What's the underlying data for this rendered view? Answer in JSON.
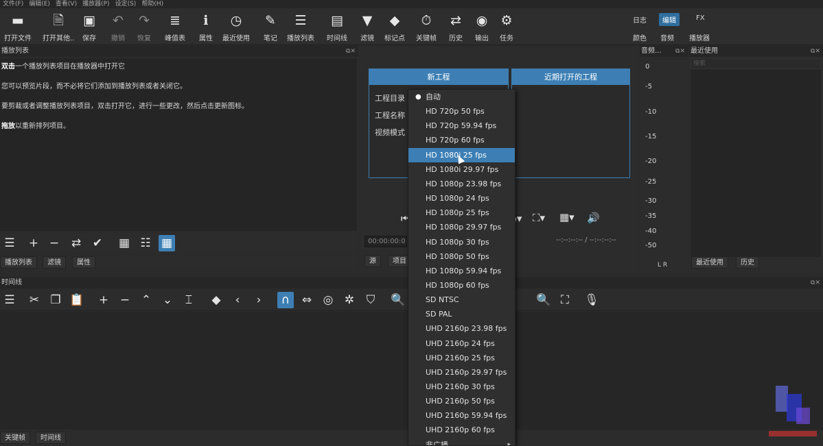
{
  "menu": [
    "文件(F)",
    "编辑(E)",
    "查看(V)",
    "播放器(P)",
    "设定(S)",
    "帮助(H)"
  ],
  "toolbar": [
    {
      "label": "打开文件",
      "icon": "open-file-icon",
      "glyph": "▬",
      "dim": false
    },
    {
      "label": "打开其他..",
      "icon": "open-other-icon",
      "glyph": "🗎",
      "dim": false
    },
    {
      "label": "保存",
      "icon": "save-icon",
      "glyph": "▣",
      "dim": false
    },
    {
      "label": "撤销",
      "icon": "undo-icon",
      "glyph": "↶",
      "dim": true
    },
    {
      "label": "恢复",
      "icon": "redo-icon",
      "glyph": "↷",
      "dim": true
    },
    {
      "label": "峰值表",
      "icon": "peak-meter-icon",
      "glyph": "≣",
      "dim": false
    },
    {
      "label": "属性",
      "icon": "info-icon",
      "glyph": "ℹ",
      "dim": false
    },
    {
      "label": "最近使用",
      "icon": "clock-icon",
      "glyph": "◷",
      "dim": false
    },
    {
      "label": "笔记",
      "icon": "notes-icon",
      "glyph": "✎",
      "dim": false
    },
    {
      "label": "播放列表",
      "icon": "playlist-icon",
      "glyph": "☰",
      "dim": false
    },
    {
      "label": "时间线",
      "icon": "timeline-icon",
      "glyph": "▤",
      "dim": false
    },
    {
      "label": "滤镜",
      "icon": "filter-icon",
      "glyph": "▼",
      "dim": false
    },
    {
      "label": "标记点",
      "icon": "marker-icon",
      "glyph": "◆",
      "dim": false
    },
    {
      "label": "关键帧",
      "icon": "keyframe-icon",
      "glyph": "⏱",
      "dim": false
    },
    {
      "label": "历史",
      "icon": "history-icon",
      "glyph": "⇄",
      "dim": false
    },
    {
      "label": "输出",
      "icon": "export-icon",
      "glyph": "◉",
      "dim": false
    },
    {
      "label": "任务",
      "icon": "jobs-icon",
      "glyph": "⚙",
      "dim": false
    }
  ],
  "modes": {
    "row1": [
      "日志",
      "编辑",
      "FX"
    ],
    "row2": [
      "颜色",
      "音频",
      "播放器"
    ],
    "active": "编辑"
  },
  "playlist": {
    "title": "播放列表",
    "lines": [
      {
        "bold": "双击",
        "rest": "一个播放列表项目在播放器中打开它"
      },
      {
        "bold": "",
        "rest": "您可以预览片段，而不必将它们添加到播放列表或者关闭它。"
      },
      {
        "bold": "",
        "rest": "要剪裁或者调整播放列表项目，双击打开它，进行一些更改，然后点击更新图标。"
      },
      {
        "bold": "拖放",
        "rest": "以重新排列项目。"
      }
    ],
    "tabs": [
      "播放列表",
      "滤镜",
      "属性"
    ]
  },
  "new_project": {
    "title": "新工程",
    "labels": [
      "工程目录",
      "工程名称",
      "视频模式"
    ]
  },
  "recent_projects": {
    "title": "近期打开的工程"
  },
  "player": {
    "timecode": "00:00:00:0",
    "duration": "--:--:--:-- / --:--:--:--",
    "tabs": [
      "源",
      "项目"
    ]
  },
  "audio": {
    "title": "音频...",
    "scale": [
      "0",
      "-5",
      "-10",
      "-15",
      "-20",
      "-25",
      "-30",
      "-35",
      "-40",
      "-50"
    ],
    "channels": "L  R"
  },
  "recent": {
    "title": "最近使用",
    "search_placeholder": "搜索",
    "tabs": [
      "最近使用",
      "历史"
    ]
  },
  "timeline": {
    "title": "时间线"
  },
  "bottom_tabs": [
    "关键帧",
    "时间线"
  ],
  "dropdown": {
    "items": [
      "自动",
      "HD 720p 50 fps",
      "HD 720p 59.94 fps",
      "HD 720p 60 fps",
      "HD 1080i 25 fps",
      "HD 1080i 29.97 fps",
      "HD 1080p 23.98 fps",
      "HD 1080p 24 fps",
      "HD 1080p 25 fps",
      "HD 1080p 29.97 fps",
      "HD 1080p 30 fps",
      "HD 1080p 50 fps",
      "HD 1080p 59.94 fps",
      "HD 1080p 60 fps",
      "SD NTSC",
      "SD PAL",
      "UHD 2160p 23.98 fps",
      "UHD 2160p 24 fps",
      "UHD 2160p 25 fps",
      "UHD 2160p 29.97 fps",
      "UHD 2160p 30 fps",
      "UHD 2160p 50 fps",
      "UHD 2160p 59.94 fps",
      "UHD 2160p 60 fps",
      "非广播"
    ],
    "checked": "自动",
    "highlighted": "HD 1080i 25 fps",
    "submenu": "非广播"
  },
  "colors": {
    "accent": "#3d7fb4",
    "bg": "#2b2b2b",
    "panel": "#252525"
  }
}
